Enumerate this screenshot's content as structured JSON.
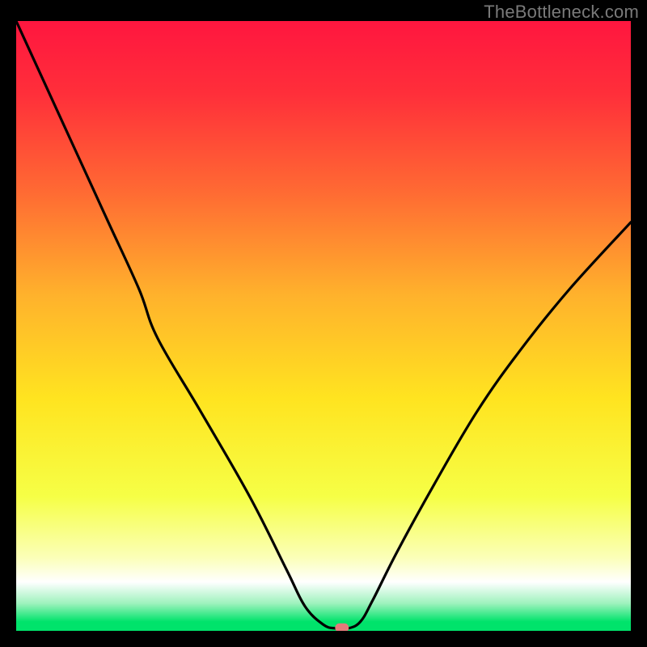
{
  "watermark": "TheBottleneck.com",
  "chart_data": {
    "type": "line",
    "title": "",
    "xlabel": "",
    "ylabel": "",
    "xlim": [
      0,
      100
    ],
    "ylim": [
      0,
      100
    ],
    "grid": false,
    "legend": false,
    "gradient_stops": [
      {
        "offset": 0.0,
        "color": "#ff163f"
      },
      {
        "offset": 0.12,
        "color": "#ff2f3a"
      },
      {
        "offset": 0.28,
        "color": "#ff6a33"
      },
      {
        "offset": 0.45,
        "color": "#ffb22c"
      },
      {
        "offset": 0.62,
        "color": "#ffe420"
      },
      {
        "offset": 0.78,
        "color": "#f6ff46"
      },
      {
        "offset": 0.88,
        "color": "#fbffb8"
      },
      {
        "offset": 0.92,
        "color": "#ffffff"
      },
      {
        "offset": 0.955,
        "color": "#9ef2bd"
      },
      {
        "offset": 0.985,
        "color": "#00e36b"
      },
      {
        "offset": 1.0,
        "color": "#00e36b"
      }
    ],
    "series": [
      {
        "name": "bottleneck-curve",
        "x": [
          0,
          5,
          10,
          15,
          20,
          23,
          30,
          38,
          44,
          47,
          50,
          52,
          54,
          56,
          58,
          62,
          68,
          75,
          82,
          90,
          100
        ],
        "y": [
          100,
          89,
          78,
          67,
          56,
          48,
          36,
          22,
          10,
          4,
          1,
          0.4,
          0.4,
          1.5,
          5,
          13,
          24,
          36,
          46,
          56,
          67
        ]
      }
    ],
    "marker": {
      "x": 53,
      "y": 0.5,
      "color": "#e47a7a"
    },
    "baseline_band": [
      0,
      1.2
    ]
  }
}
